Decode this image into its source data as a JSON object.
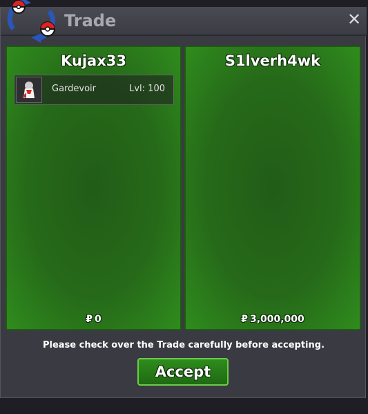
{
  "window": {
    "title": "Trade",
    "close_label": "✕"
  },
  "left_panel": {
    "trainer_name": "Kujax33",
    "pokemon": [
      {
        "name": "Gardevoir",
        "level": "Lvl: 100",
        "icon": "gardevoir-sprite-icon"
      }
    ],
    "currency_symbol": "₽",
    "money": "0"
  },
  "right_panel": {
    "trainer_name": "S1lverh4wk",
    "pokemon": [],
    "currency_symbol": "₽",
    "money": "3,000,000"
  },
  "footer": {
    "notice": "Please check over the Trade carefully before accepting.",
    "accept_label": "Accept"
  },
  "colors": {
    "panel_green": "#266a19",
    "accept_border": "#6ccc4a",
    "window_bg": "#3a3a42"
  }
}
